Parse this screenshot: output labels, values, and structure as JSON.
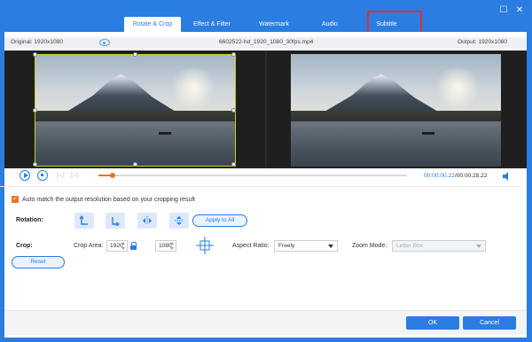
{
  "window": {
    "minimize_symbol": "☐",
    "close_symbol": "✕"
  },
  "tabs": [
    {
      "label": "Rotate & Crop",
      "active": true
    },
    {
      "label": "Effect & Filter",
      "active": false
    },
    {
      "label": "Watermark",
      "active": false
    },
    {
      "label": "Audio",
      "active": false
    },
    {
      "label": "Subtitle",
      "active": false
    }
  ],
  "infobar": {
    "original": "Original: 1920x1080",
    "filename": "6602522-hd_1920_1080_30fps.mp4",
    "output": "Output: 1920x1080"
  },
  "playback": {
    "current_time": "00:00:00.22",
    "separator": "/",
    "total_time": "00:00:28.22",
    "progress": 0.045
  },
  "options": {
    "auto_match_label": "Auto match the output resolution based on your cropping result",
    "auto_match_checked": true,
    "checkmark": "✓"
  },
  "rotation": {
    "label": "Rotation:",
    "apply_all_label": "Apply to All"
  },
  "crop": {
    "label": "Crop:",
    "area_label": "Crop Area:",
    "width": "1920",
    "height": "1080",
    "aspect_label": "Aspect Ratio:",
    "aspect_value": "Freely",
    "zoom_label": "Zoom Mode:",
    "zoom_value": "Letter Box",
    "reset_label": "Reset"
  },
  "footer": {
    "ok_label": "OK",
    "cancel_label": "Cancel"
  },
  "colors": {
    "accent": "#2a7de1",
    "highlight": "#e0302a",
    "crop_border": "#c5d321",
    "progress": "#f07030"
  }
}
